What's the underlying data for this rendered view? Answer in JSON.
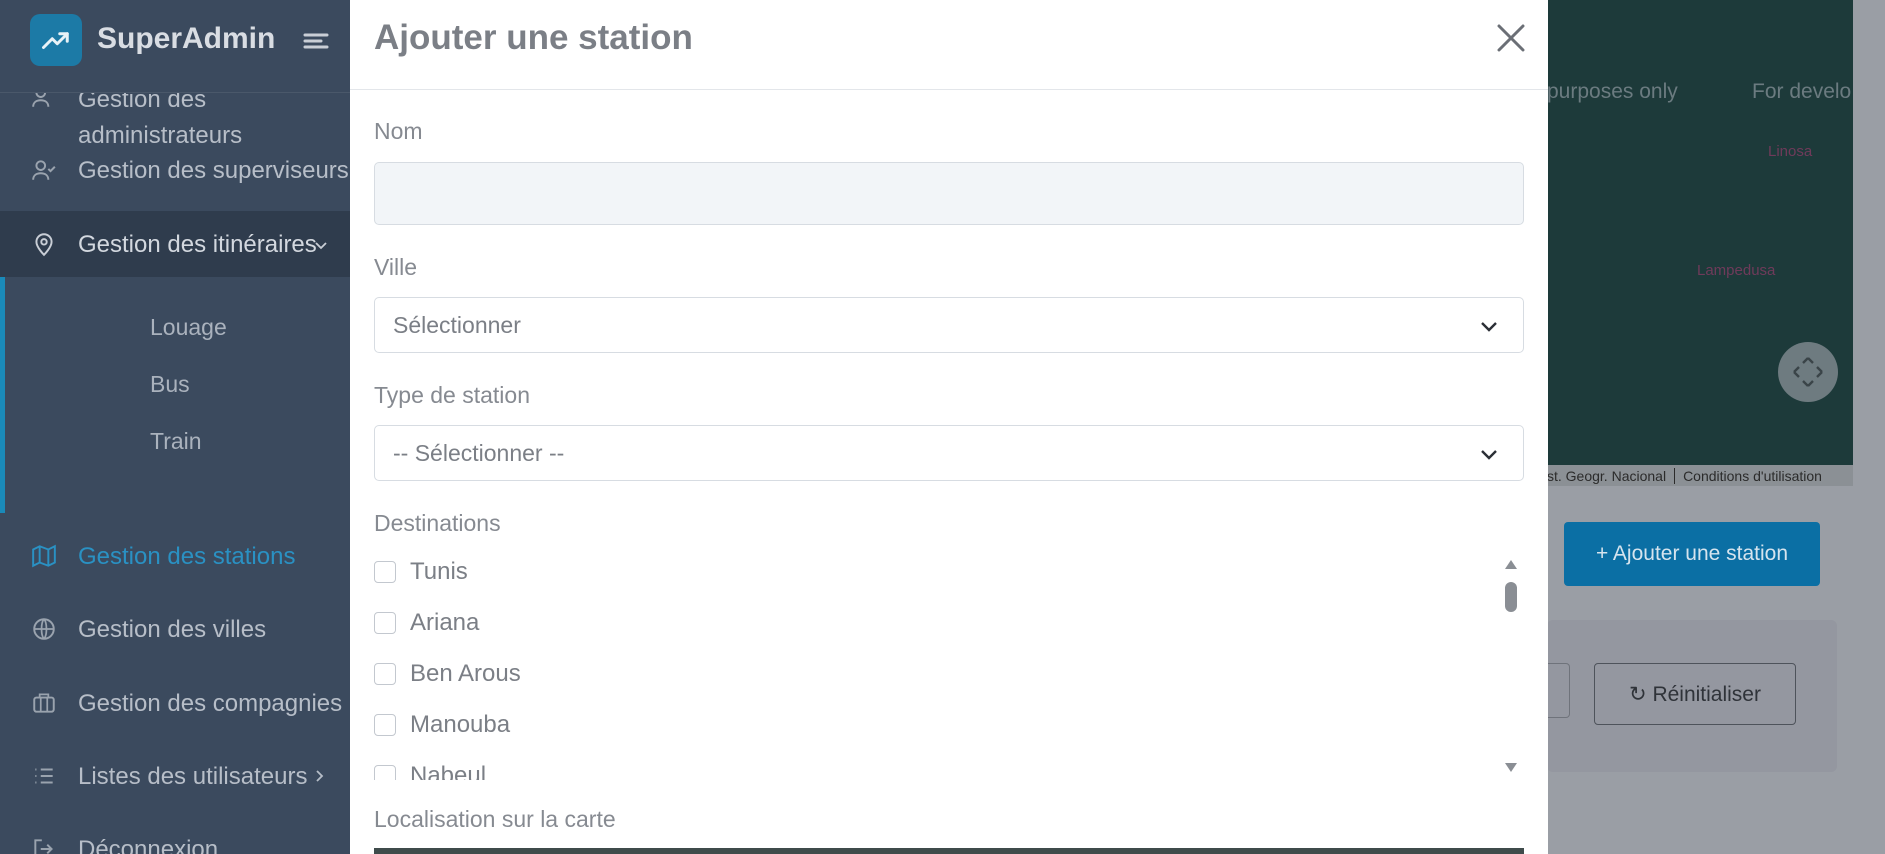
{
  "sidebar": {
    "brand": "SuperAdmin",
    "items": [
      {
        "label": "Gestion des\nadministrateurs",
        "icon": "users-icon"
      },
      {
        "label": "Gestion des superviseurs",
        "icon": "user-check-icon"
      },
      {
        "label": "Gestion des itinéraires",
        "icon": "map-pin-icon"
      },
      {
        "label": "Gestion des stations",
        "icon": "map-icon"
      },
      {
        "label": "Gestion des villes",
        "icon": "globe-icon"
      },
      {
        "label": "Gestion des compagnies",
        "icon": "briefcase-icon"
      },
      {
        "label": "Listes des utilisateurs",
        "icon": "list-icon"
      },
      {
        "label": "Déconnexion",
        "icon": "logout-icon"
      }
    ],
    "sub_items": [
      "Louage",
      "Bus",
      "Train"
    ]
  },
  "background": {
    "map_text_1": "purposes only",
    "map_text_2": "For develo",
    "city_1": "Linosa",
    "city_2": "Lampedusa",
    "attribution_1": "st. Geogr. Nacional",
    "attribution_2": "Conditions d'utilisation",
    "add_station_label": "+ Ajouter une station",
    "reset_label": "↻ Réinitialiser"
  },
  "modal": {
    "title": "Ajouter une station",
    "name_label": "Nom",
    "name_value": "",
    "city_label": "Ville",
    "city_value": "Sélectionner",
    "type_label": "Type de station",
    "type_value": "-- Sélectionner --",
    "destinations_label": "Destinations",
    "destinations": [
      "Tunis",
      "Ariana",
      "Ben Arous",
      "Manouba",
      "Nabeul"
    ],
    "map_label": "Localisation sur la carte"
  }
}
